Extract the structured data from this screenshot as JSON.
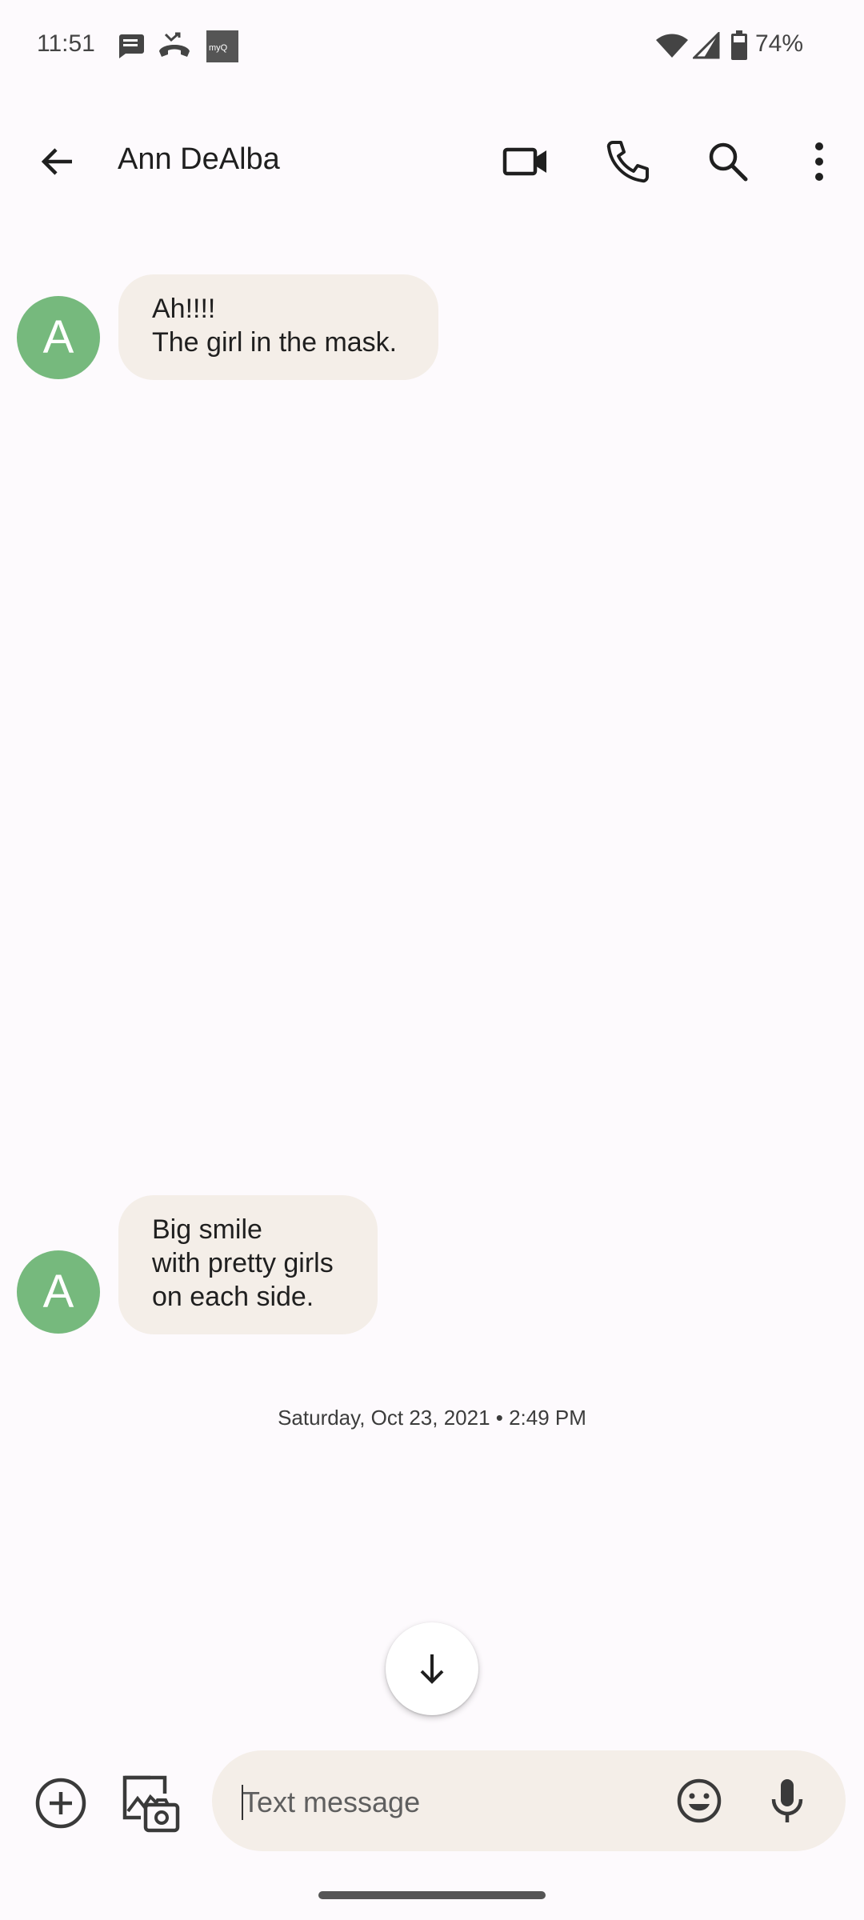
{
  "status_bar": {
    "time": "11:51",
    "battery_pct": "74%",
    "notification_icons": [
      "message-icon",
      "missed-call-icon",
      "myq-icon"
    ],
    "myq_label": "myQ"
  },
  "app_bar": {
    "contact_name": "Ann DeAlba",
    "actions": [
      "video-call-icon",
      "phone-icon",
      "search-icon",
      "more-vert-icon"
    ]
  },
  "messages": [
    {
      "avatar_letter": "A",
      "lines": [
        "Ah!!!!",
        "The girl in the mask."
      ]
    },
    {
      "avatar_letter": "A",
      "lines": [
        "Big smile",
        "with pretty girls",
        "on each side."
      ]
    }
  ],
  "timestamp": "Saturday, Oct 23, 2021 • 2:49 PM",
  "compose": {
    "placeholder": "Text message"
  },
  "colors": {
    "background": "#FDFAFD",
    "bubble": "#F4EEE8",
    "avatar": "#76B97D"
  }
}
